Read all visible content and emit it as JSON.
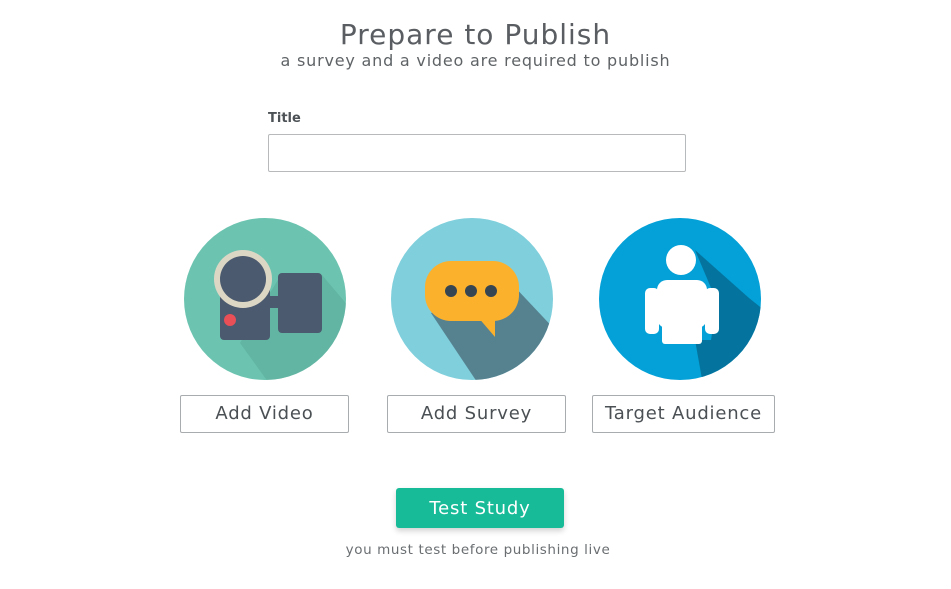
{
  "header": {
    "title": "Prepare to Publish",
    "subtitle": "a survey and a video are required to publish"
  },
  "form": {
    "title_label": "Title",
    "title_value": "",
    "title_placeholder": ""
  },
  "cards": [
    {
      "icon": "video-camera-icon",
      "button_label": "Add Video",
      "color": "#6cc4b0"
    },
    {
      "icon": "chat-bubble-icon",
      "button_label": "Add Survey",
      "color": "#7fcfdc"
    },
    {
      "icon": "person-icon",
      "button_label": "Target Audience",
      "color": "#03a1d7"
    }
  ],
  "footer": {
    "test_button_label": "Test Study",
    "test_note": "you must test before publishing live",
    "accent_color": "#17bb98"
  }
}
